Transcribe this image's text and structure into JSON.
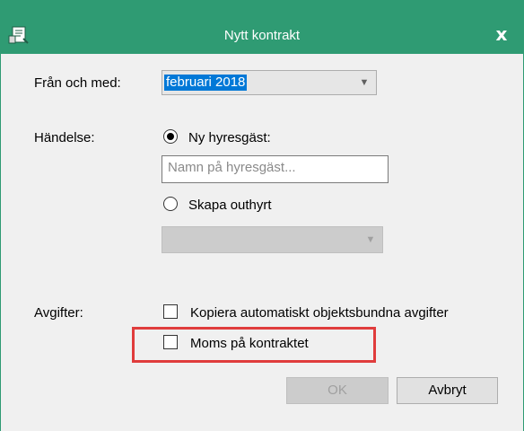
{
  "window": {
    "title": "Nytt kontrakt",
    "close_glyph": "x",
    "icon": "contract-document-icon"
  },
  "form": {
    "from_label": "Från och med:",
    "from_value": "februari 2018",
    "event_label": "Händelse:",
    "new_tenant_label": "Ny hyresgäst:",
    "new_tenant_checked": true,
    "tenant_placeholder": "Namn på hyresgäst...",
    "create_vacant_label": "Skapa outhyrt",
    "create_vacant_checked": false,
    "fees_label": "Avgifter:",
    "copy_fees_label": "Kopiera automatiskt objektsbundna avgifter",
    "copy_fees_checked": false,
    "vat_label": "Moms på kontraktet",
    "vat_checked": false
  },
  "buttons": {
    "ok": "OK",
    "cancel": "Avbryt"
  },
  "colors": {
    "titlebar": "#2f9b73",
    "highlight": "#e03c3c",
    "selection": "#0078d7"
  }
}
